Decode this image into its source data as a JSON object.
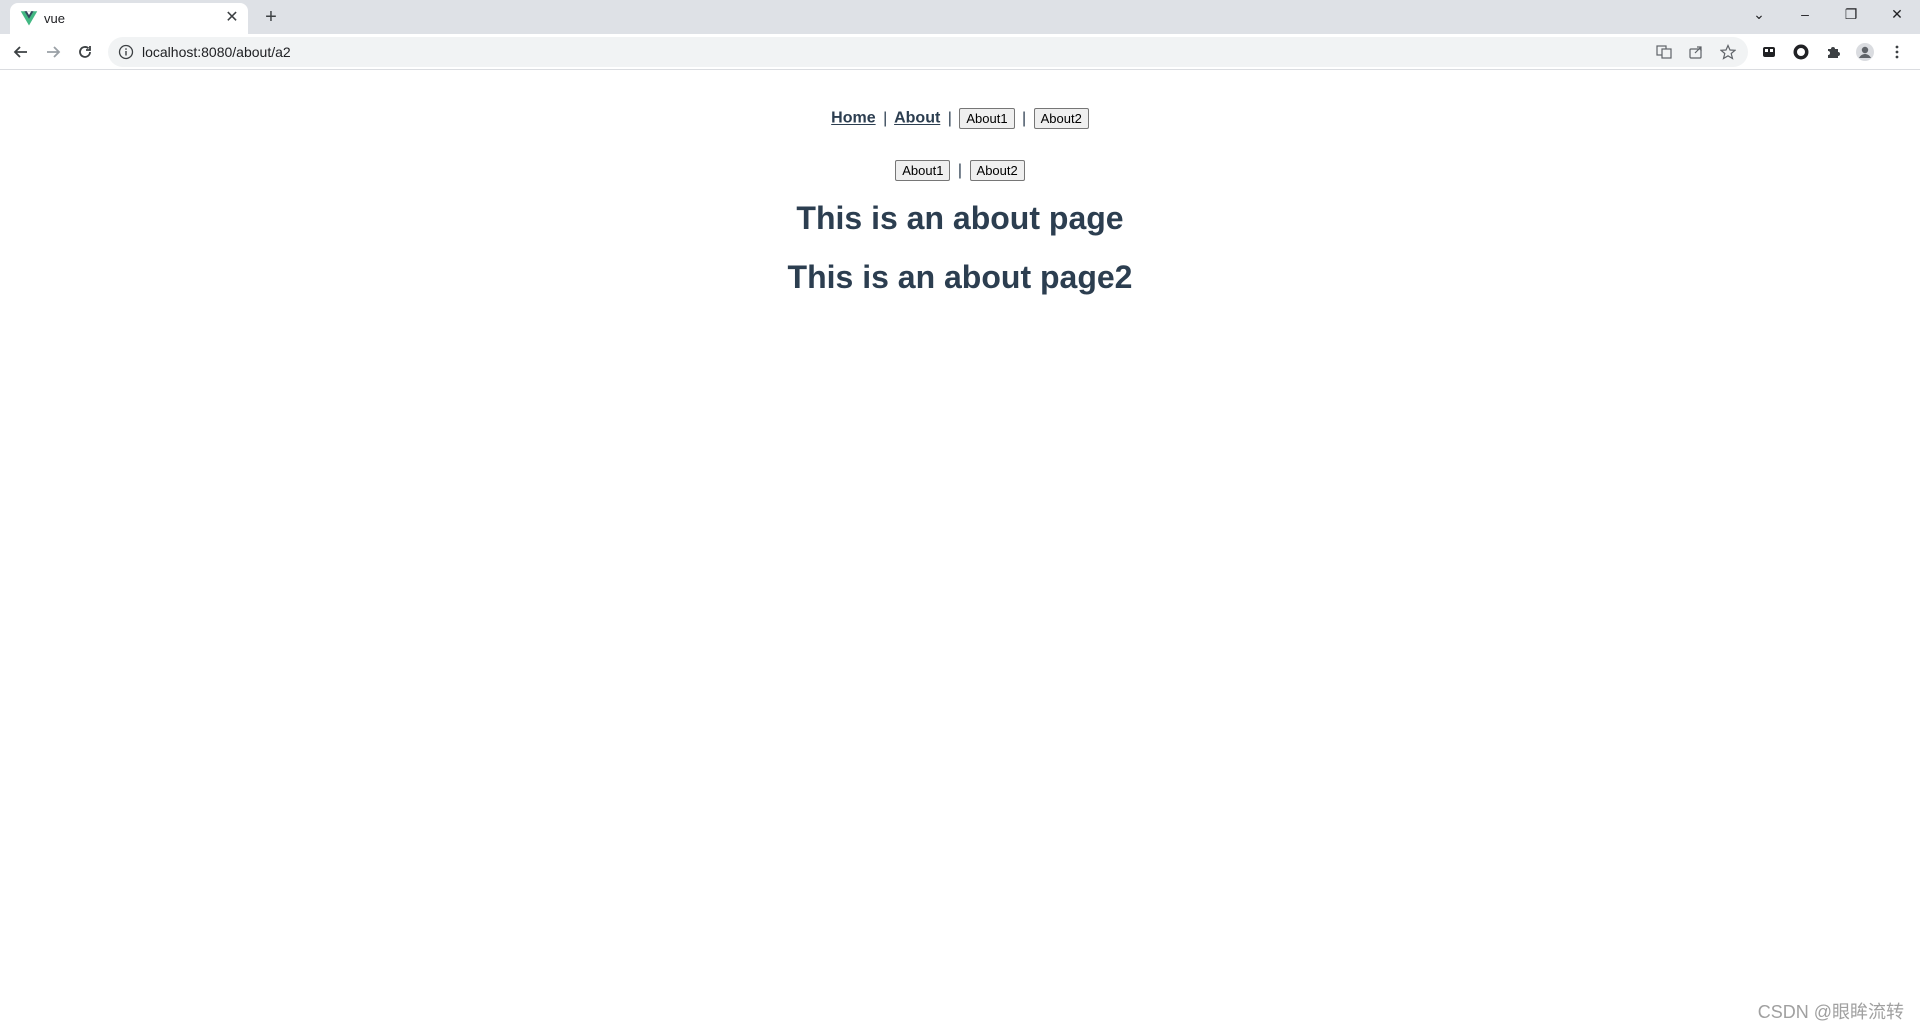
{
  "browser": {
    "tab": {
      "title": "vue",
      "close_glyph": "✕"
    },
    "new_tab_glyph": "+",
    "window_controls": {
      "dropdown": "⌄",
      "minimize": "–",
      "restore": "❐",
      "close": "✕"
    },
    "address": {
      "url": "localhost:8080/about/a2"
    },
    "icons": [
      "back-icon",
      "forward-icon",
      "reload-icon",
      "info-icon",
      "translate-icon",
      "share-icon",
      "star-icon",
      "media-icon",
      "extension-circle-icon",
      "puzzle-icon",
      "profile-icon",
      "menu-icon"
    ]
  },
  "page": {
    "nav": {
      "home": "Home",
      "about": "About",
      "sep": "|",
      "about1_btn": "About1",
      "about2_btn": "About2"
    },
    "subnav": {
      "about1_btn": "About1",
      "sep": "|",
      "about2_btn": "About2"
    },
    "heading1": "This is an about page",
    "heading2": "This is an about page2"
  },
  "watermark": "CSDN @眼眸流转",
  "colors": {
    "text": "#2c3e50",
    "vue_green": "#42b883",
    "vue_dark": "#35495e"
  }
}
